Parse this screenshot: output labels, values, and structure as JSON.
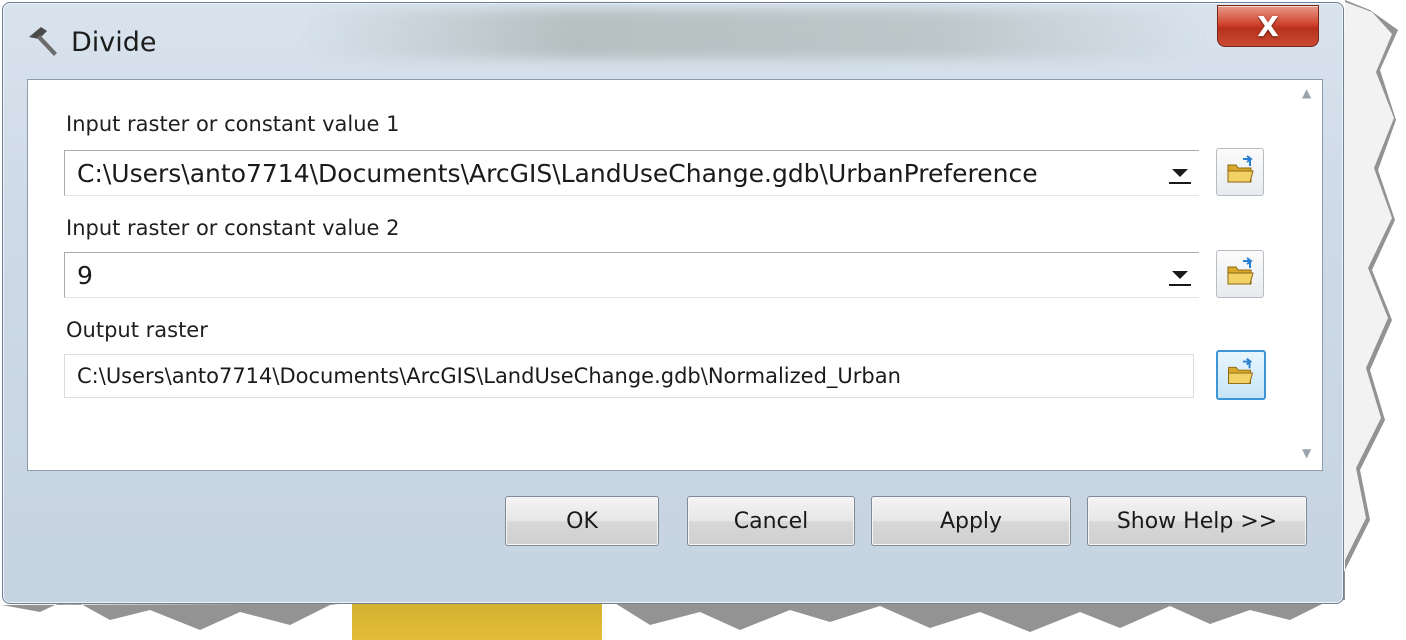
{
  "window": {
    "title": "Divide",
    "title_icon": "hammer-icon",
    "close_icon": "close-icon",
    "close_label": "X"
  },
  "fields": {
    "input1": {
      "label": "Input raster or constant value 1",
      "value": "C:\\Users\\anto7714\\Documents\\ArcGIS\\LandUseChange.gdb\\UrbanPreference"
    },
    "input2": {
      "label": "Input raster or constant value 2",
      "value": "9"
    },
    "output": {
      "label": "Output raster",
      "value": "C:\\Users\\anto7714\\Documents\\ArcGIS\\LandUseChange.gdb\\Normalized_Urban"
    }
  },
  "buttons": {
    "ok": "OK",
    "cancel": "Cancel",
    "apply": "Apply",
    "show_help": "Show Help >>"
  },
  "icons": {
    "browse": "open-folder-icon",
    "dropdown": "dropdown-arrow-icon"
  },
  "colors": {
    "close_red": "#c8432d",
    "focus_blue": "#3d95d6",
    "folder_yellow": "#e8c34a"
  }
}
